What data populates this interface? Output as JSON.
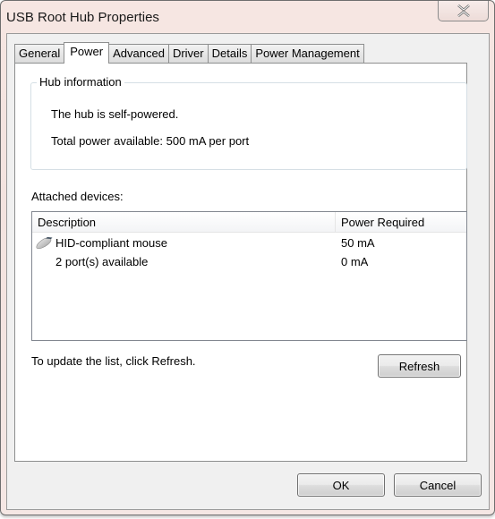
{
  "window": {
    "title": "USB Root Hub Properties",
    "close_icon": "close-x-icon"
  },
  "tabs": [
    {
      "label": "General",
      "active": false
    },
    {
      "label": "Power",
      "active": true
    },
    {
      "label": "Advanced",
      "active": false
    },
    {
      "label": "Driver",
      "active": false
    },
    {
      "label": "Details",
      "active": false
    },
    {
      "label": "Power Management",
      "active": false
    }
  ],
  "hub_info": {
    "legend": "Hub information",
    "power_mode": "The hub is self-powered.",
    "total_power": "Total power available:  500 mA per port"
  },
  "attached": {
    "label": "Attached devices:",
    "columns": [
      "Description",
      "Power Required"
    ],
    "rows": [
      {
        "icon": "mouse-icon",
        "description": "HID-compliant mouse",
        "power": "50 mA"
      },
      {
        "icon": "",
        "description": "2 port(s) available",
        "power": "0 mA"
      }
    ]
  },
  "refresh": {
    "hint": "To update the list, click Refresh.",
    "button_label": "Refresh"
  },
  "footer": {
    "ok_label": "OK",
    "cancel_label": "Cancel"
  }
}
